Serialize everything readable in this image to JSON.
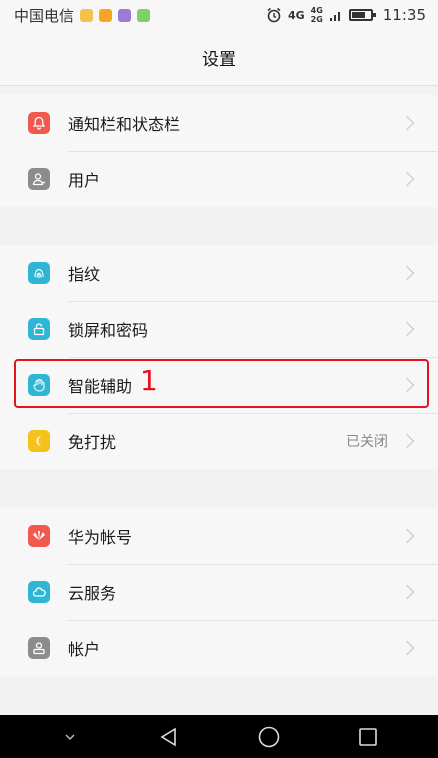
{
  "status_bar": {
    "carrier": "中国电信",
    "network": "4G",
    "network_small_top": "4G",
    "network_small_bottom": "2G",
    "time": "11:35"
  },
  "header": {
    "title": "设置"
  },
  "groups": [
    {
      "items": [
        {
          "label": "通知栏和状态栏",
          "icon": "bell-icon",
          "color": "#f0594e"
        },
        {
          "label": "用户",
          "icon": "user-icon",
          "color": "#8c8c8c"
        }
      ]
    },
    {
      "items": [
        {
          "label": "指纹",
          "icon": "fingerprint-icon",
          "color": "#2fb6d6"
        },
        {
          "label": "锁屏和密码",
          "icon": "lock-icon",
          "color": "#2fb6d6"
        },
        {
          "label": "智能辅助",
          "icon": "hand-icon",
          "color": "#2fb6d6"
        },
        {
          "label": "免打扰",
          "icon": "moon-icon",
          "color": "#f5c21b",
          "value": "已关闭"
        }
      ]
    },
    {
      "items": [
        {
          "label": "华为帐号",
          "icon": "huawei-logo-icon",
          "color": "#f0594e"
        },
        {
          "label": "云服务",
          "icon": "cloud-icon",
          "color": "#2fb6d6"
        },
        {
          "label": "帐户",
          "icon": "account-icon",
          "color": "#8c8c8c"
        }
      ]
    }
  ],
  "annotation": {
    "label": "1"
  }
}
